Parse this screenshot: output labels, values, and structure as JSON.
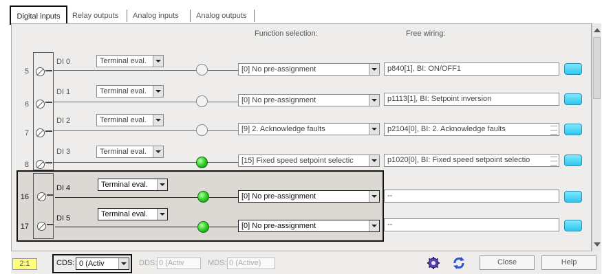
{
  "tabs": [
    {
      "label": "Digital inputs",
      "active": true
    },
    {
      "label": "Relay outputs",
      "active": false
    },
    {
      "label": "Analog inputs",
      "active": false
    },
    {
      "label": "Analog outputs",
      "active": false
    }
  ],
  "columns": {
    "function": "Function selection:",
    "wiring": "Free wiring:"
  },
  "rows": [
    {
      "num": "5",
      "di": "DI 0",
      "eval": "Terminal eval.",
      "led": "off",
      "function": "[0] No pre-assignment",
      "wiring": "p840[1], BI: ON/OFF1"
    },
    {
      "num": "6",
      "di": "DI 1",
      "eval": "Terminal eval.",
      "led": "off",
      "function": "[0] No pre-assignment",
      "wiring": "p1113[1], BI: Setpoint inversion"
    },
    {
      "num": "7",
      "di": "DI 2",
      "eval": "Terminal eval.",
      "led": "off",
      "function": "[9] 2. Acknowledge faults",
      "wiring": "p2104[0], BI: 2. Acknowledge faults"
    },
    {
      "num": "8",
      "di": "DI 3",
      "eval": "Terminal eval.",
      "led": "on",
      "function": "[15] Fixed speed setpoint selectic",
      "wiring": "p1020[0], BI: Fixed speed setpoint selectio"
    },
    {
      "num": "16",
      "di": "DI 4",
      "eval": "Terminal eval.",
      "led": "on",
      "function": "[0] No pre-assignment",
      "wiring": "--"
    },
    {
      "num": "17",
      "di": "DI 5",
      "eval": "Terminal eval.",
      "led": "on",
      "function": "[0] No pre-assignment",
      "wiring": "--"
    }
  ],
  "status": {
    "id": "2:1",
    "cds_label": "CDS:",
    "cds_value": "0 (Activ",
    "dds_label": "DDS:",
    "dds_value": "0 (Activ",
    "mds_label": "MDS:",
    "mds_value": "0 (Active)"
  },
  "buttons": {
    "close": "Close",
    "help": "Help"
  },
  "colors": {
    "highlight_border": "#111111",
    "status_yellow": "#ffff7a",
    "led_on": "#37d62a",
    "plug": "#2fc6ee"
  }
}
